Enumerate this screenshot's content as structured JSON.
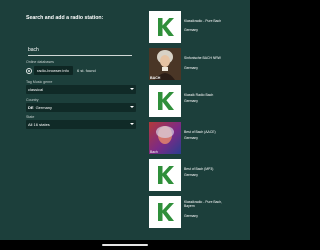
{
  "search": {
    "title": "Search and add a radio station:",
    "query": "bach"
  },
  "databases": {
    "label": "Online databases",
    "source": "radio-browser.info",
    "count": "6 st. found"
  },
  "genre": {
    "label": "Tag Music genre",
    "value": "classical"
  },
  "country": {
    "label": "Country",
    "code": "DE",
    "value": "Germany"
  },
  "state": {
    "label": "State",
    "value": "All 16 states"
  },
  "results": [
    {
      "title": "Klassikradio - Pure Bach",
      "country": "Germany",
      "icon": "klassik-radio-logo"
    },
    {
      "title": "Sinfonische BACH NRW",
      "country": "Germany",
      "icon": "bach-portrait",
      "caption": "BACH"
    },
    {
      "title": "Klassik Radio Bach",
      "country": "Germany",
      "icon": "klassik-radio-logo"
    },
    {
      "title": "Best of Bach (AACE)",
      "country": "Germany",
      "icon": "colorful-artwork",
      "caption": "Bach"
    },
    {
      "title": "Best of Bach (MP3)",
      "country": "Germany",
      "icon": "klassik-radio-logo"
    },
    {
      "title": "Klassikradio - Pure Bach, Bayern",
      "country": "Germany",
      "icon": "klassik-radio-logo"
    }
  ],
  "colors": {
    "background": "#1c3f3b",
    "brand_green": "#2f8f3a",
    "field": "#102a27"
  }
}
